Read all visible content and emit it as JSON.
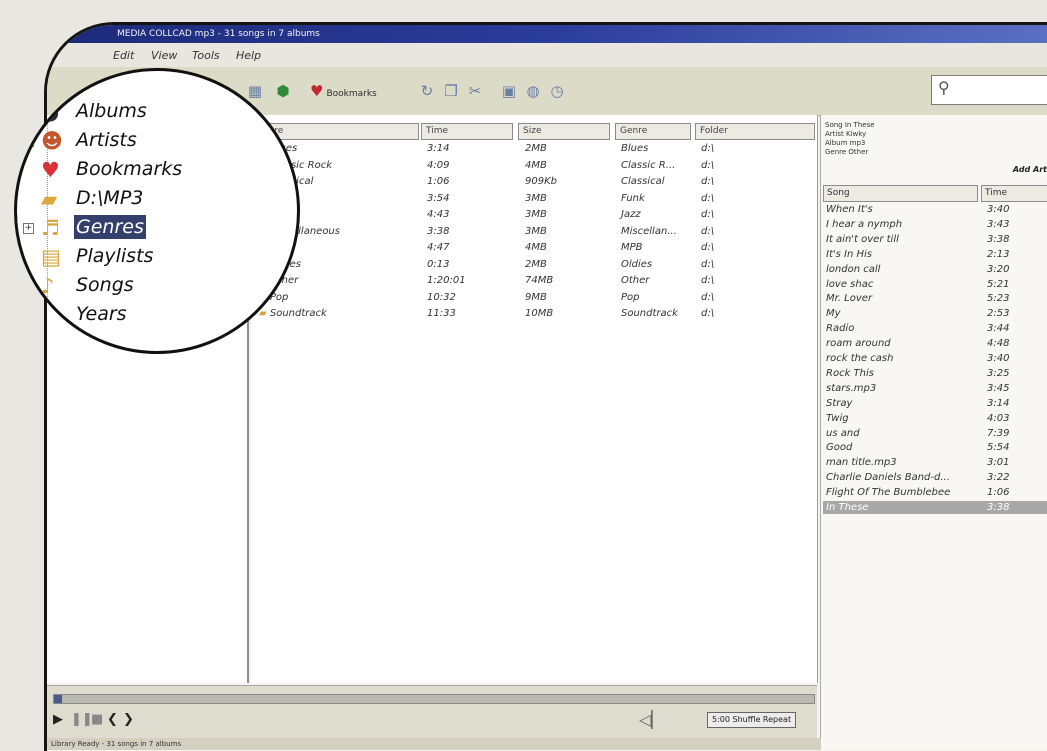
{
  "window": {
    "title": "MEDIA COLLCAD mp3 - 31 songs in 7 albums"
  },
  "menu": [
    "Edit",
    "View",
    "Tools",
    "Help"
  ],
  "toolbar": {
    "bookmarks_label": "Bookmarks"
  },
  "tree": [
    {
      "label": "Albums",
      "icon": "cd-icon",
      "expand": ""
    },
    {
      "label": "Artists",
      "icon": "artist-icon",
      "expand": "+"
    },
    {
      "label": "Bookmarks",
      "icon": "heart-icon",
      "expand": ""
    },
    {
      "label": "D:\\MP3",
      "icon": "folder-icon",
      "expand": ""
    },
    {
      "label": "Genres",
      "icon": "genres-icon",
      "expand": "+"
    },
    {
      "label": "Playlists",
      "icon": "playlist-icon",
      "expand": ""
    },
    {
      "label": "Songs",
      "icon": "songs-icon",
      "expand": "+"
    },
    {
      "label": "Years",
      "icon": "years-icon",
      "expand": ""
    }
  ],
  "list": {
    "columns": [
      "Genre",
      "Time",
      "Size",
      "Genre",
      "Folder"
    ],
    "rows": [
      {
        "name": "Blues",
        "time": "3:14",
        "size": "2MB",
        "genre": "Blues",
        "folder": "d:\\"
      },
      {
        "name": "Classic Rock",
        "time": "4:09",
        "size": "4MB",
        "genre": "Classic R...",
        "folder": "d:\\"
      },
      {
        "name": "Classical",
        "time": "1:06",
        "size": "909Kb",
        "genre": "Classical",
        "folder": "d:\\"
      },
      {
        "name": "Funk",
        "time": "3:54",
        "size": "3MB",
        "genre": "Funk",
        "folder": "d:\\"
      },
      {
        "name": "Jazz",
        "time": "4:43",
        "size": "3MB",
        "genre": "Jazz",
        "folder": "d:\\"
      },
      {
        "name": "Miscellaneous",
        "time": "3:38",
        "size": "3MB",
        "genre": "Miscellan...",
        "folder": "d:\\"
      },
      {
        "name": "MPB",
        "time": "4:47",
        "size": "4MB",
        "genre": "MPB",
        "folder": "d:\\"
      },
      {
        "name": "Oldies",
        "time": "0:13",
        "size": "2MB",
        "genre": "Oldies",
        "folder": "d:\\"
      },
      {
        "name": "Other",
        "time": "1:20:01",
        "size": "74MB",
        "genre": "Other",
        "folder": "d:\\"
      },
      {
        "name": "Pop",
        "time": "10:32",
        "size": "9MB",
        "genre": "Pop",
        "folder": "d:\\"
      },
      {
        "name": "Soundtrack",
        "time": "11:33",
        "size": "10MB",
        "genre": "Soundtrack",
        "folder": "d:\\"
      }
    ]
  },
  "nowplaying": {
    "info": [
      "Song    In These",
      "Artist  Kiwky",
      "Album   mp3",
      "Genre   Other"
    ],
    "add_label": "Add Art"
  },
  "playlist": {
    "columns": [
      "Song",
      "Time"
    ],
    "rows": [
      [
        "When It's",
        "3:40"
      ],
      [
        "I hear a nymph",
        "3:43"
      ],
      [
        "It ain't over till",
        "3:38"
      ],
      [
        "It's In His",
        "2:13"
      ],
      [
        "london call",
        "3:20"
      ],
      [
        "love shac",
        "5:21"
      ],
      [
        "Mr. Lover",
        "5:23"
      ],
      [
        "My",
        "2:53"
      ],
      [
        "Radio",
        "3:44"
      ],
      [
        "roam around",
        "4:48"
      ],
      [
        "rock the cash",
        "3:40"
      ],
      [
        "Rock This",
        "3:25"
      ],
      [
        "stars.mp3",
        "3:45"
      ],
      [
        "Stray",
        "3:14"
      ],
      [
        "Twig",
        "4:03"
      ],
      [
        "us and",
        "7:39"
      ],
      [
        "Good",
        "5:54"
      ],
      [
        "man title.mp3",
        "3:01"
      ],
      [
        "Charlie Daniels Band-d...",
        "3:22"
      ],
      [
        "Flight Of The Bumblebee",
        "1:06"
      ],
      [
        "In These",
        "3:38"
      ]
    ],
    "selected_index": 20
  },
  "player": {
    "timebox": "5:00 Shuffle Repeat",
    "progress": 0.01
  },
  "statusbar": "Library Ready - 31 songs in 7 albums"
}
